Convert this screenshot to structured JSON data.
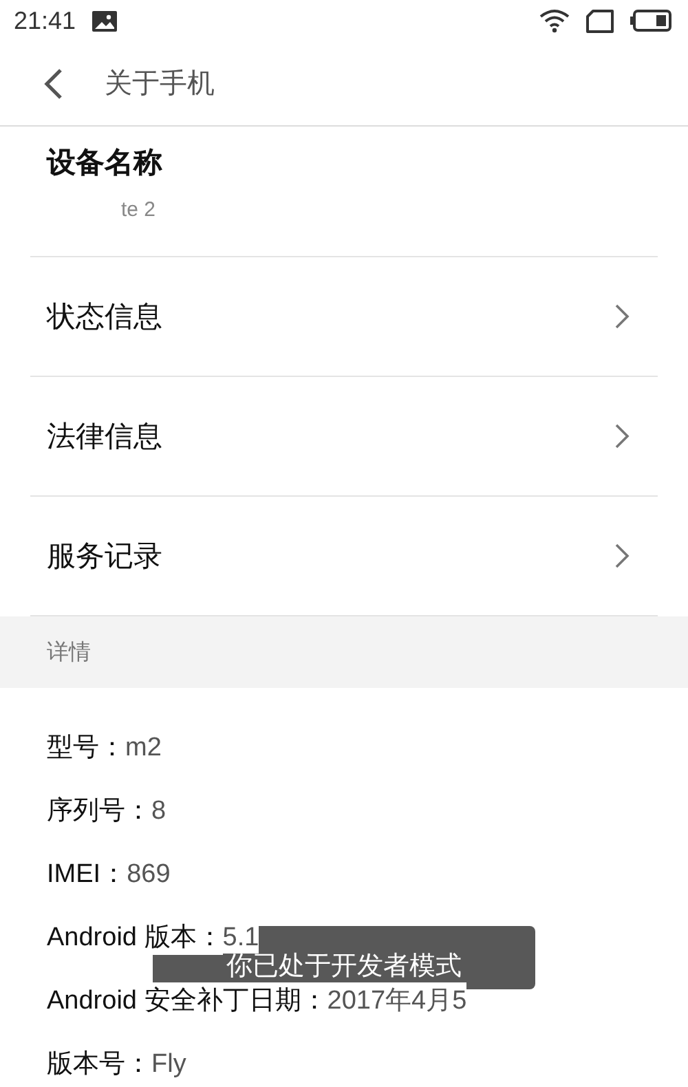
{
  "status_bar": {
    "time": "21:41"
  },
  "header": {
    "title": "关于手机"
  },
  "device_name": {
    "label": "设备名称",
    "value": "te 2"
  },
  "menu_items": [
    {
      "label": "状态信息"
    },
    {
      "label": "法律信息"
    },
    {
      "label": "服务记录"
    }
  ],
  "section": {
    "title": "详情"
  },
  "details": [
    {
      "label": "型号：",
      "value": "m2"
    },
    {
      "label": "序列号：",
      "value": "8"
    },
    {
      "label": "IMEI：",
      "value": "869"
    },
    {
      "label": "Android 版本：",
      "value": "5.1"
    },
    {
      "label": "Android 安全补丁日期：",
      "value": "2017年4月5"
    },
    {
      "label": "版本号：",
      "value": "Fly"
    }
  ],
  "toast": {
    "message": "你已处于开发者模式"
  }
}
